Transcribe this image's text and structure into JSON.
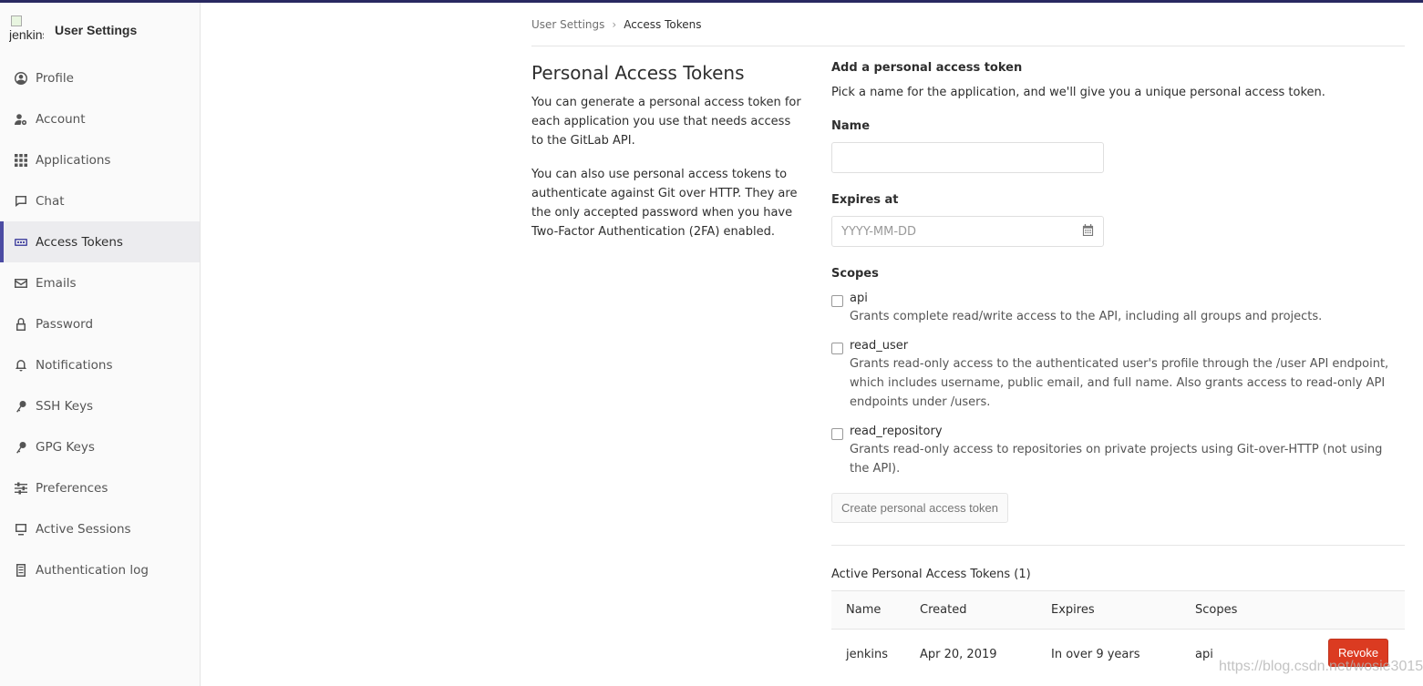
{
  "sidebar": {
    "avatar_alt": "jenkins",
    "title": "User Settings",
    "items": [
      {
        "label": "Profile",
        "icon": "user-circle-icon"
      },
      {
        "label": "Account",
        "icon": "user-gear-icon"
      },
      {
        "label": "Applications",
        "icon": "grid-icon"
      },
      {
        "label": "Chat",
        "icon": "comment-icon"
      },
      {
        "label": "Access Tokens",
        "icon": "token-icon",
        "active": true
      },
      {
        "label": "Emails",
        "icon": "envelope-icon"
      },
      {
        "label": "Password",
        "icon": "lock-icon"
      },
      {
        "label": "Notifications",
        "icon": "bell-icon"
      },
      {
        "label": "SSH Keys",
        "icon": "key-icon"
      },
      {
        "label": "GPG Keys",
        "icon": "key-icon"
      },
      {
        "label": "Preferences",
        "icon": "sliders-icon"
      },
      {
        "label": "Active Sessions",
        "icon": "monitor-icon"
      },
      {
        "label": "Authentication log",
        "icon": "list-icon"
      }
    ]
  },
  "breadcrumb": {
    "parent": "User Settings",
    "current": "Access Tokens"
  },
  "left": {
    "title": "Personal Access Tokens",
    "p1": "You can generate a personal access token for each application you use that needs access to the GitLab API.",
    "p2": "You can also use personal access tokens to authenticate against Git over HTTP. They are the only accepted password when you have Two-Factor Authentication (2FA) enabled."
  },
  "form": {
    "title": "Add a personal access token",
    "desc": "Pick a name for the application, and we'll give you a unique personal access token.",
    "name_label": "Name",
    "name_value": "",
    "expires_label": "Expires at",
    "expires_placeholder": "YYYY-MM-DD",
    "scopes_label": "Scopes",
    "scopes": [
      {
        "name": "api",
        "desc": "Grants complete read/write access to the API, including all groups and projects."
      },
      {
        "name": "read_user",
        "desc": "Grants read-only access to the authenticated user's profile through the /user API endpoint, which includes username, public email, and full name. Also grants access to read-only API endpoints under /users."
      },
      {
        "name": "read_repository",
        "desc": "Grants read-only access to repositories on private projects using Git-over-HTTP (not using the API)."
      }
    ],
    "create_label": "Create personal access token"
  },
  "tokens": {
    "title": "Active Personal Access Tokens (1)",
    "headers": [
      "Name",
      "Created",
      "Expires",
      "Scopes"
    ],
    "rows": [
      {
        "name": "jenkins",
        "created": "Apr 20, 2019",
        "expires": "In over 9 years",
        "scopes": "api",
        "revoke_label": "Revoke"
      }
    ]
  },
  "watermark": "https://blog.csdn.net/wosie3015",
  "colors": {
    "accent": "#4b4ba3",
    "danger": "#db3b21",
    "topbar": "#292961"
  }
}
